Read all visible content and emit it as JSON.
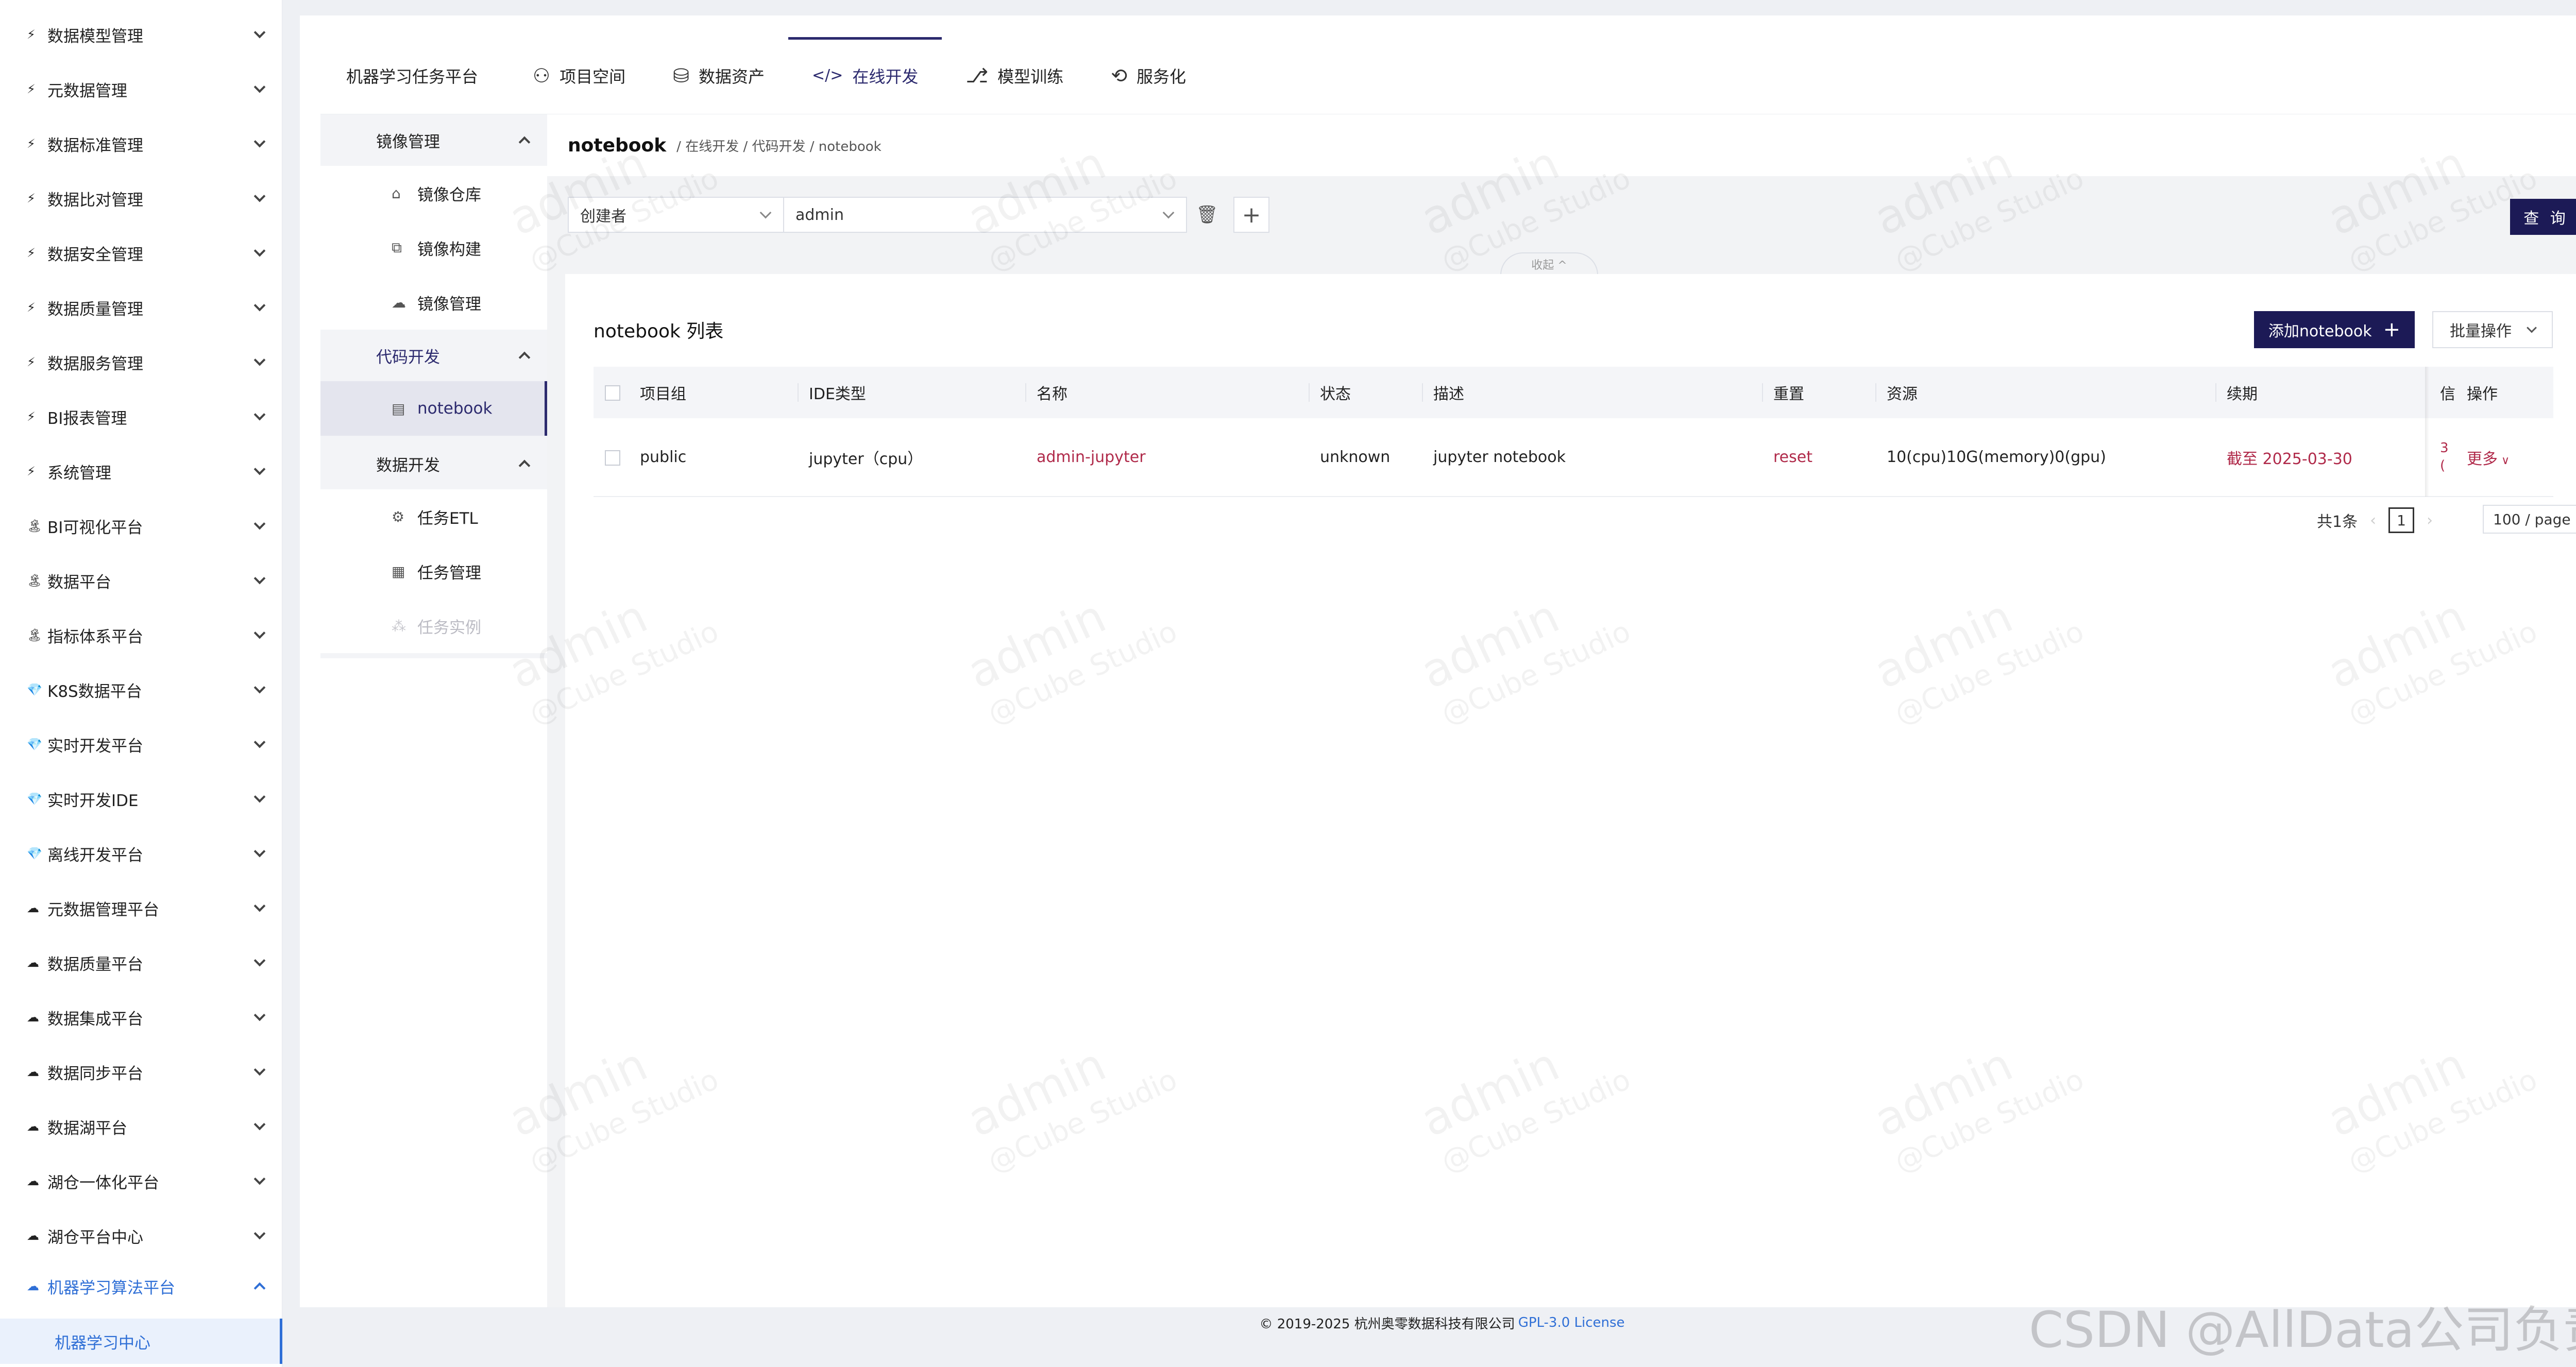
{
  "sidebar": {
    "items": [
      {
        "icon": "⚡",
        "label": "数据模型管理"
      },
      {
        "icon": "⚡",
        "label": "元数据管理"
      },
      {
        "icon": "⚡",
        "label": "数据标准管理"
      },
      {
        "icon": "⚡",
        "label": "数据比对管理"
      },
      {
        "icon": "⚡",
        "label": "数据安全管理"
      },
      {
        "icon": "⚡",
        "label": "数据质量管理"
      },
      {
        "icon": "⚡",
        "label": "数据服务管理"
      },
      {
        "icon": "⚡",
        "label": "BI报表管理"
      },
      {
        "icon": "⚡",
        "label": "系统管理"
      },
      {
        "icon": "🏝",
        "label": "BI可视化平台"
      },
      {
        "icon": "🏝",
        "label": "数据平台"
      },
      {
        "icon": "🏝",
        "label": "指标体系平台"
      },
      {
        "icon": "💎",
        "label": "K8S数据平台"
      },
      {
        "icon": "💎",
        "label": "实时开发平台"
      },
      {
        "icon": "💎",
        "label": "实时开发IDE"
      },
      {
        "icon": "💎",
        "label": "离线开发平台"
      },
      {
        "icon": "☁",
        "label": "元数据管理平台"
      },
      {
        "icon": "☁",
        "label": "数据质量平台"
      },
      {
        "icon": "☁",
        "label": "数据集成平台"
      },
      {
        "icon": "☁",
        "label": "数据同步平台"
      },
      {
        "icon": "☁",
        "label": "数据湖平台"
      },
      {
        "icon": "☁",
        "label": "湖仓一体化平台"
      },
      {
        "icon": "☁",
        "label": "湖仓平台中心"
      },
      {
        "icon": "☁",
        "label": "机器学习算法平台"
      }
    ],
    "sub_item": "机器学习中心"
  },
  "topnav": {
    "platform": "机器学习任务平台",
    "tabs": [
      {
        "icon": "⚇",
        "label": "项目空间"
      },
      {
        "icon": "⛁",
        "label": "数据资产"
      },
      {
        "icon": "</>",
        "label": "在线开发"
      },
      {
        "icon": "⎇",
        "label": "模型训练"
      },
      {
        "icon": "⟲",
        "label": "服务化"
      }
    ]
  },
  "side2": {
    "group1": "镜像管理",
    "group1_items": [
      {
        "icon": "⌂",
        "label": "镜像仓库"
      },
      {
        "icon": "⧉",
        "label": "镜像构建"
      },
      {
        "icon": "☁",
        "label": "镜像管理"
      }
    ],
    "group2": "代码开发",
    "group2_items": [
      {
        "icon": "▤",
        "label": "notebook"
      }
    ],
    "group3": "数据开发",
    "group3_items": [
      {
        "icon": "⚙",
        "label": "任务ETL"
      },
      {
        "icon": "▦",
        "label": "任务管理"
      },
      {
        "icon": "⁂",
        "label": "任务实例"
      }
    ]
  },
  "page": {
    "title": "notebook",
    "breadcrumb": "/ 在线开发 / 代码开发 / notebook"
  },
  "filter": {
    "field": "创建者",
    "value": "admin",
    "query_label": "查 询",
    "collapse_label": "收起 ^"
  },
  "list": {
    "title": "notebook 列表",
    "add_label": "添加notebook",
    "batch_label": "批量操作",
    "columns": [
      "项目组",
      "IDE类型",
      "名称",
      "状态",
      "描述",
      "重置",
      "资源",
      "续期",
      "信",
      "操作"
    ],
    "rows": [
      {
        "project": "public",
        "ide": "jupyter（cpu）",
        "name": "admin-jupyter",
        "status": "unknown",
        "desc": "jupyter notebook",
        "reset": "reset",
        "resource": "10(cpu)10G(memory)0(gpu)",
        "renew": "截至 2025-03-30",
        "info": "3\n(",
        "action": "更多"
      }
    ]
  },
  "pagination": {
    "total": "共1条",
    "current": "1",
    "page_size": "100 / page"
  },
  "footer": {
    "copyright": "© 2019-2025 杭州奥零数据科技有限公司",
    "license": "GPL-3.0 License"
  },
  "watermark": {
    "line1": "admin",
    "line2": "@Cube Studio"
  },
  "csdn": "CSDN @AllData公司负责人",
  "colors": {
    "accent": "#1c1a56",
    "link": "#2f6fd6",
    "red": "#b02a4a"
  }
}
